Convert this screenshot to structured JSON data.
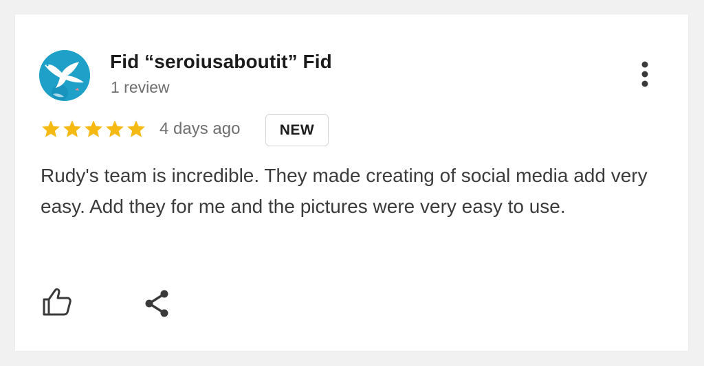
{
  "review": {
    "author": {
      "name": "Fid “seroiusaboutit” Fid",
      "review_count": "1 review",
      "avatar_icon": "bird-logo-icon"
    },
    "rating": 5,
    "date": "4 days ago",
    "badge": "NEW",
    "text": "Rudy's team is incredible. They made creating of social media add very easy. Add they for me and the pictures were very easy to use."
  },
  "icons": {
    "more": "more-vert-icon",
    "like": "thumbs-up-icon",
    "share": "share-icon",
    "star": "star-icon"
  },
  "colors": {
    "star": "#f5b914",
    "avatar_bg": "#1ea0c9",
    "name_text": "#1b1b1b",
    "secondary_text": "#6f6f6f",
    "body_text": "#3b3b3b",
    "badge_border": "#d5d5d5"
  }
}
